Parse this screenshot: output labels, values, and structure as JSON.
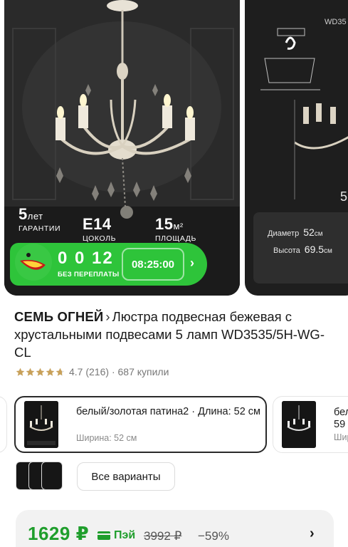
{
  "gallery": {
    "features": [
      {
        "value": "5",
        "unit": "лет",
        "caption": "ГАРАНТИИ"
      },
      {
        "value": "E14",
        "unit": "",
        "caption": "ЦОКОЛЬ"
      },
      {
        "value": "15",
        "unit": "м²",
        "caption": "ПЛОЩАДЬ"
      }
    ],
    "next_slide": {
      "code": "WD35",
      "diameter_label": "Диаметр",
      "diameter_value": "52",
      "diameter_unit": "см",
      "height_label": "Высота",
      "height_value": "69.5",
      "height_unit": "см",
      "side_value": "5"
    },
    "promo": {
      "count": "0 0 12",
      "subtitle": "БЕЗ ПЕРЕПЛАТЫ",
      "timer": "08:25:00",
      "arrow": "›"
    }
  },
  "product": {
    "brand": "СЕМЬ ОГНЕЙ",
    "brand_chevron": "›",
    "name": "Люстра подвесная бежевая с хрустальными подвесами 5 ламп WD3535/5H-WG-CL",
    "rating": "4.7",
    "reviews": "(216)",
    "separator": "·",
    "bought": "687 купили"
  },
  "variants": {
    "selected": {
      "title": "белый/золотая патина2 · Длина: 52 см",
      "subtitle": "Ширина: 52 см"
    },
    "next": {
      "title_line1": "бел",
      "title_line2": "59",
      "subtitle": "Шир"
    },
    "all_label": "Все варианты"
  },
  "price": {
    "current": "1629 ₽",
    "pay_label": "Пэй",
    "old": "3992 ₽",
    "discount": "−59%",
    "arrow": "›"
  },
  "colors": {
    "accent_green": "#2ec43a",
    "price_green": "#1f9e2c",
    "star": "#f2a23b"
  }
}
